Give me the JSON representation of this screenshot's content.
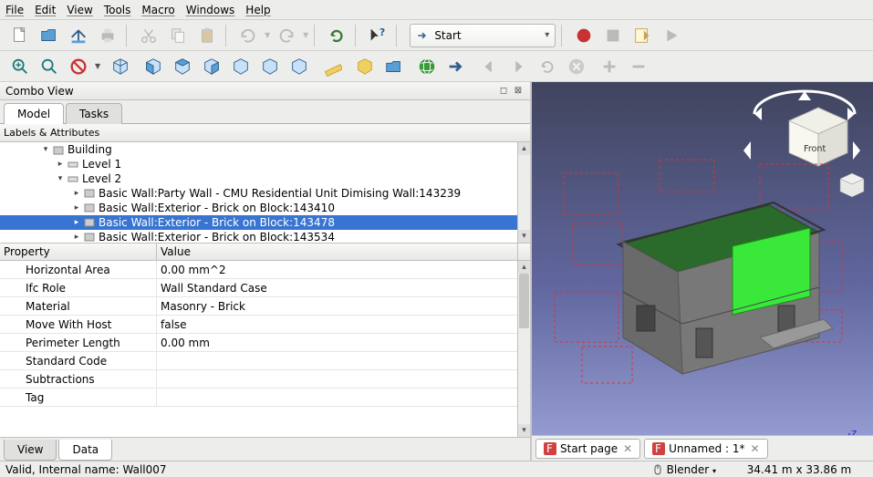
{
  "menu": [
    "File",
    "Edit",
    "View",
    "Tools",
    "Macro",
    "Windows",
    "Help"
  ],
  "workbench": {
    "label": "Start"
  },
  "combo": {
    "title": "Combo View",
    "tabs": {
      "model": "Model",
      "tasks": "Tasks"
    },
    "labels_header": "Labels & Attributes",
    "tree": {
      "building": "Building",
      "level1": "Level 1",
      "level2": "Level 2",
      "items": [
        "Basic Wall:Party Wall - CMU Residential Unit Dimising Wall:143239",
        "Basic Wall:Exterior - Brick on Block:143410",
        "Basic Wall:Exterior - Brick on Block:143478",
        "Basic Wall:Exterior - Brick on Block:143534"
      ]
    },
    "prop_header": {
      "col1": "Property",
      "col2": "Value"
    },
    "props": [
      {
        "name": "Horizontal Area",
        "value": "0.00 mm^2"
      },
      {
        "name": "Ifc Role",
        "value": "Wall Standard Case"
      },
      {
        "name": "Material",
        "value": "Masonry - Brick"
      },
      {
        "name": "Move With Host",
        "value": "false"
      },
      {
        "name": "Perimeter Length",
        "value": "0.00 mm"
      },
      {
        "name": "Standard Code",
        "value": ""
      },
      {
        "name": "Subtractions",
        "value": ""
      },
      {
        "name": "Tag",
        "value": ""
      }
    ],
    "bottom_tabs": {
      "view": "View",
      "data": "Data"
    }
  },
  "navcube": {
    "face": "Front"
  },
  "view_tabs": [
    {
      "label": "Start page",
      "close": true
    },
    {
      "label": "Unnamed : 1*",
      "close": true
    }
  ],
  "status": {
    "left": "Valid, Internal name: Wall007",
    "mode": "Blender",
    "dims": "34.41 m x 33.86 m"
  }
}
